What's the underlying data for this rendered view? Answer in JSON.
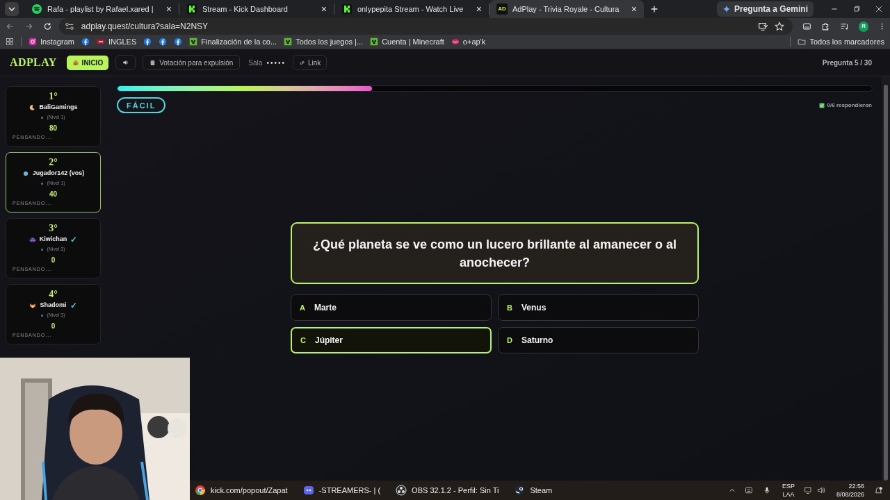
{
  "browser": {
    "tabs": [
      {
        "kind": "spotify",
        "title": "Rafa - playlist by Rafael.xared |",
        "close": "×",
        "selected": false
      },
      {
        "kind": "kick",
        "title": "Stream - Kick Dashboard",
        "close": "×",
        "selected": false
      },
      {
        "kind": "kick",
        "title": "onlypepita Stream - Watch Live",
        "close": "×",
        "selected": false
      },
      {
        "kind": "adplay",
        "badge": "AD",
        "title": "AdPlay - Trivia Royale - Cultura",
        "close": "×",
        "selected": true
      }
    ],
    "gemini_button": "Pregunta a Gemini",
    "address": "adplay.quest/cultura?sala=N2NSY",
    "profile_initial": "R",
    "bookmarks": [
      {
        "kind": "instagram",
        "label": "Instagram"
      },
      {
        "kind": "facebook"
      },
      {
        "kind": "ingles",
        "label": "INGLES"
      },
      {
        "kind": "facebook"
      },
      {
        "kind": "facebook"
      },
      {
        "kind": "facebook"
      },
      {
        "kind": "minecraft",
        "label": "Finalización de la co..."
      },
      {
        "kind": "minecraft",
        "label": "Todos los juegos |..."
      },
      {
        "kind": "minecraft",
        "label": "Cuenta | Minecraft"
      },
      {
        "kind": "lips",
        "label": "o+ap'k"
      }
    ],
    "all_bookmarks": "Todos los marcadores"
  },
  "header": {
    "logo": "ADPLAY",
    "home_button": "INICIO",
    "vote_button": "Votación para expulsión",
    "room_label": "Sala",
    "room_code": "•••••",
    "link_button": "Link",
    "question_counter": "Pregunta 5 / 30"
  },
  "players": [
    {
      "rank": "1°",
      "kind": "moon",
      "name": "BaliGamings",
      "answered": false,
      "level_label": "(Nivel 1)",
      "score": "80",
      "status": "PENSANDO...",
      "selected": false
    },
    {
      "rank": "2°",
      "kind": "dot",
      "name": "Jugador142 (vos)",
      "answered": false,
      "level_label": "(Nivel 1)",
      "score": "40",
      "status": "PENSANDO...",
      "selected": true
    },
    {
      "rank": "3°",
      "kind": "alien",
      "name": "Kiwichan",
      "answered": true,
      "check": "✓",
      "level_label": "(Nivel 3)",
      "score": "0",
      "status": "PENSANDO...",
      "selected": false
    },
    {
      "rank": "4°",
      "kind": "fox",
      "name": "Shadomi",
      "answered": true,
      "check": "✓",
      "level_label": "(Nivel 3)",
      "score": "0",
      "status": "PENSANDO...",
      "selected": false
    }
  ],
  "progress": {
    "level": 0.337
  },
  "difficulty": "FÁCIL",
  "answered_count": "0/6 respondieron",
  "question": "¿Qué planeta se ve como un lucero brillante al amanecer o al anochecer?",
  "options": [
    {
      "letter": "A",
      "text": "Marte",
      "selected": false
    },
    {
      "letter": "B",
      "text": "Venus",
      "selected": false
    },
    {
      "letter": "C",
      "text": "Júpiter",
      "selected": true
    },
    {
      "letter": "D",
      "text": "Saturno",
      "selected": false
    }
  ],
  "taskbar": {
    "apps": [
      {
        "kind": "chrome",
        "label": "kick.com/popout/Zapat"
      },
      {
        "kind": "discord",
        "label": "-STREAMERS- | ("
      },
      {
        "kind": "obs",
        "label": "OBS 32.1.2 - Perfil: Sin Ti"
      },
      {
        "kind": "steam",
        "label": "Steam"
      }
    ],
    "language": "ESP",
    "layout": "LAA",
    "time": "22:56",
    "date": "8/08/2026"
  }
}
